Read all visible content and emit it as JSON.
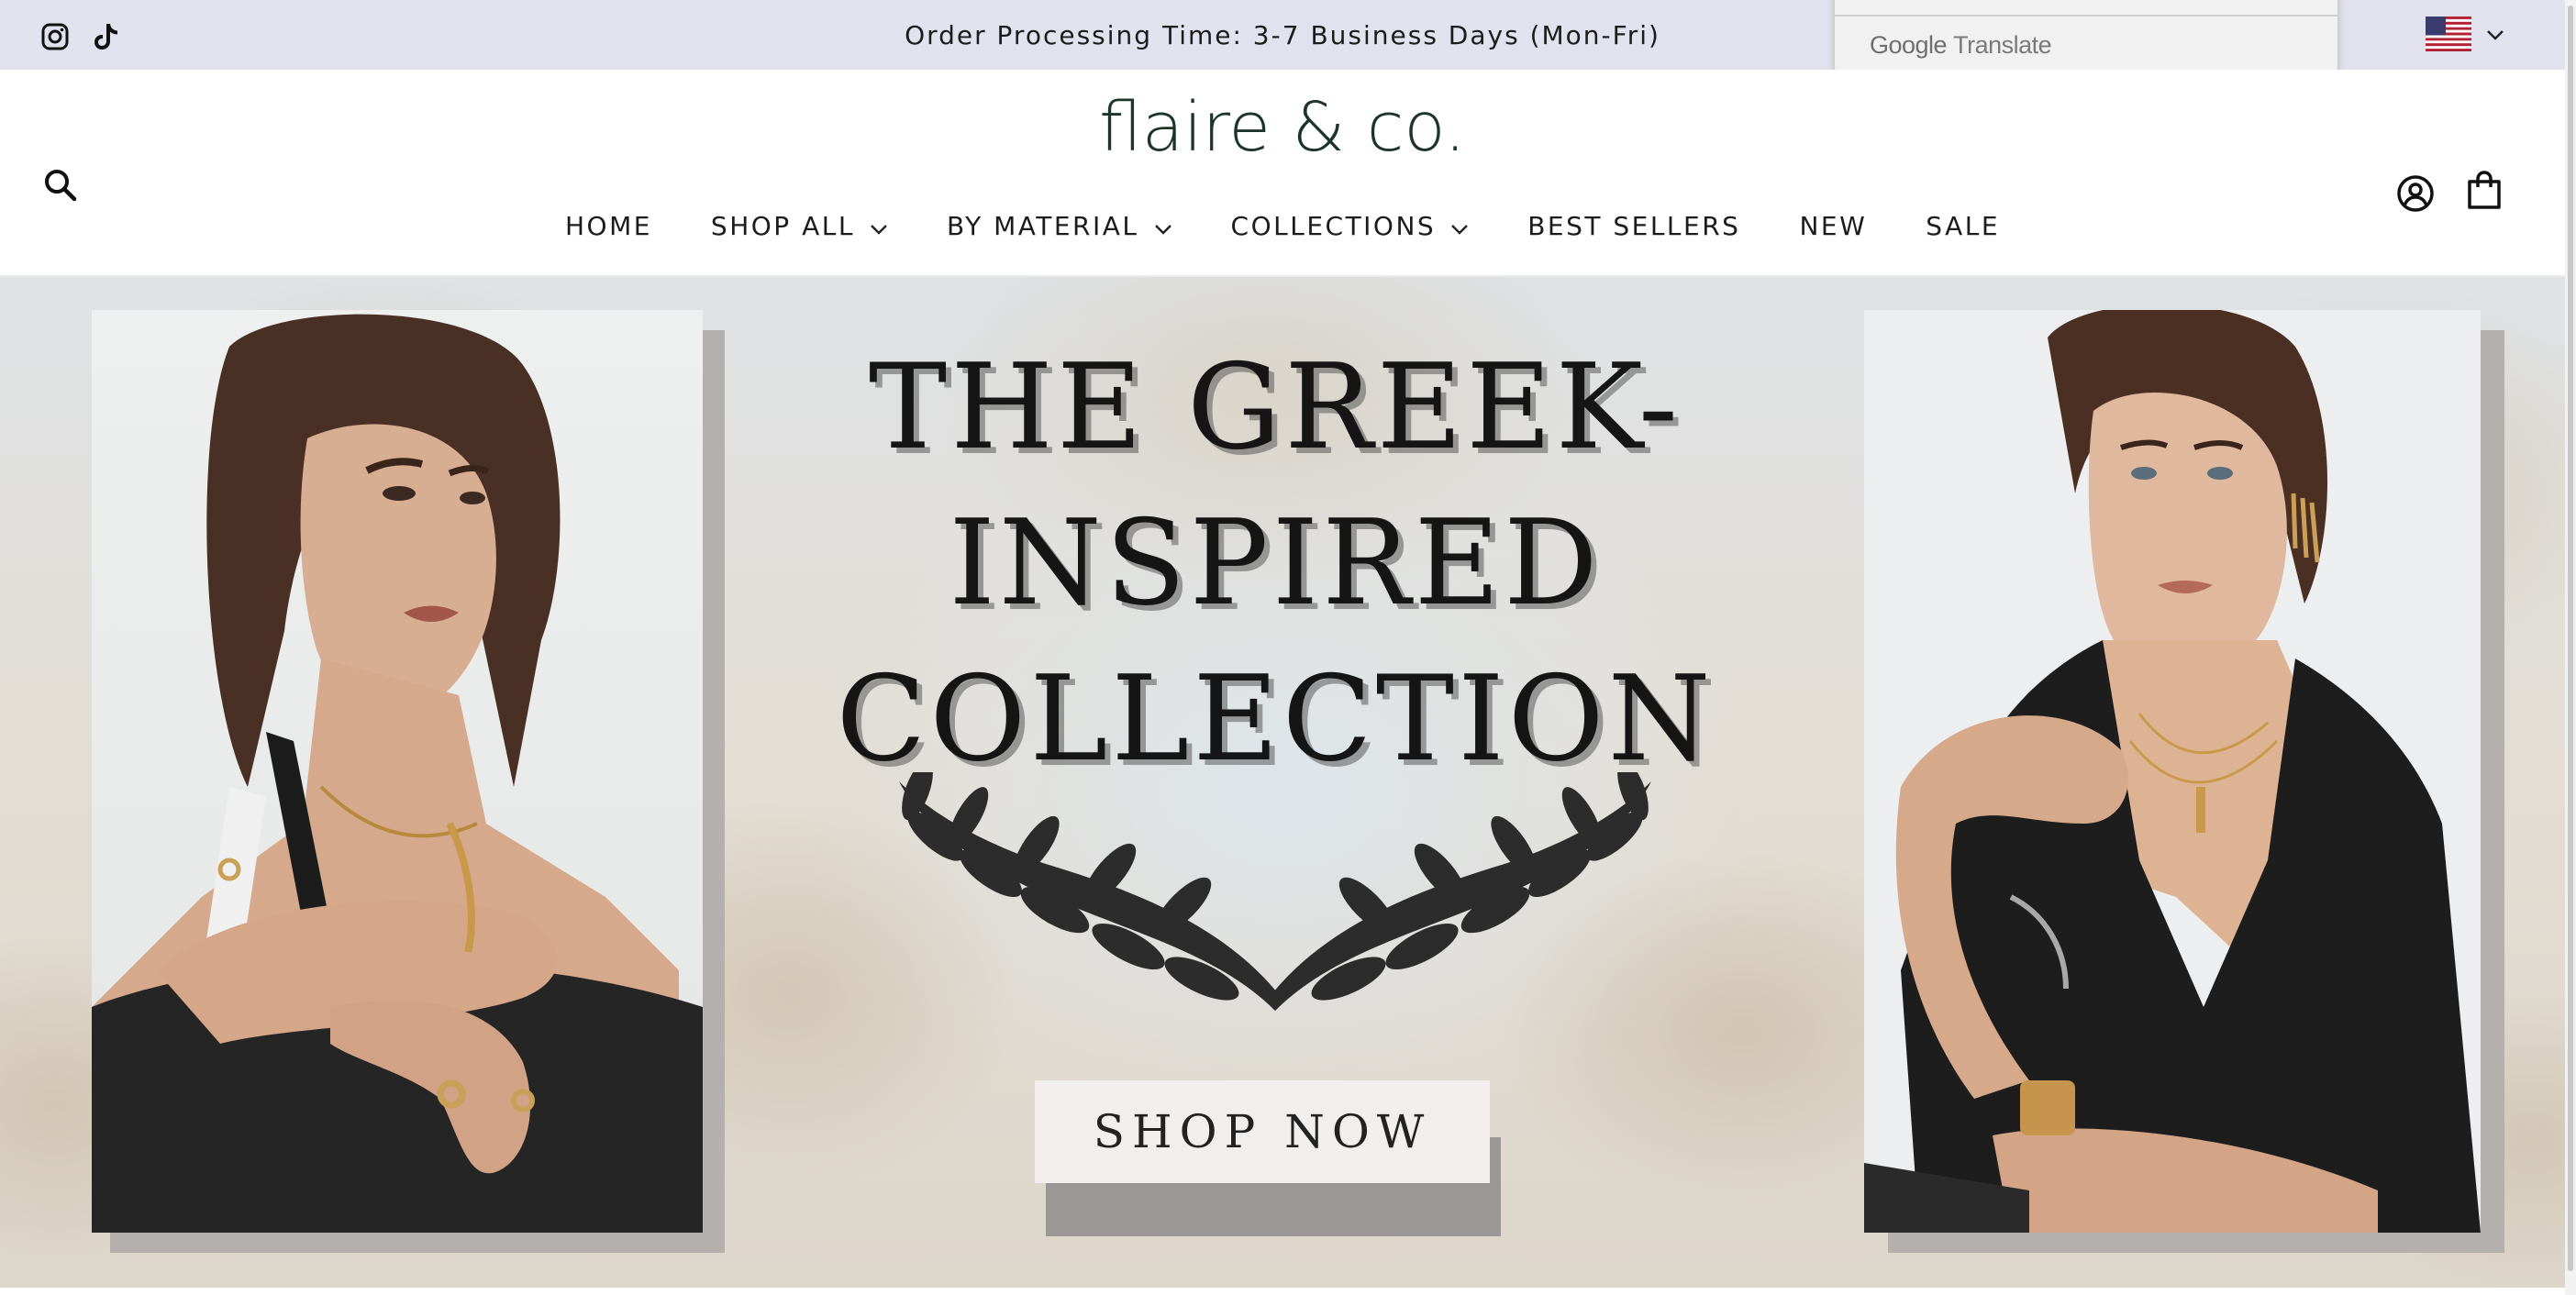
{
  "announcement": {
    "text": "Order Processing Time: 3-7 Business Days (Mon-Fri)",
    "social": [
      "instagram-icon",
      "tiktok-icon"
    ],
    "background": "#e2e1ee"
  },
  "translate": {
    "google": "Google",
    "translate": "Translate"
  },
  "header": {
    "logo": "flaire & co.",
    "logo_color": "#1d3529",
    "icons": [
      "search-icon",
      "account-icon",
      "cart-icon"
    ]
  },
  "nav": {
    "items": [
      {
        "label": "HOME",
        "dropdown": false
      },
      {
        "label": "SHOP ALL",
        "dropdown": true
      },
      {
        "label": "BY MATERIAL",
        "dropdown": true
      },
      {
        "label": "COLLECTIONS",
        "dropdown": true
      },
      {
        "label": "BEST SELLERS",
        "dropdown": false
      },
      {
        "label": "NEW",
        "dropdown": false
      },
      {
        "label": "SALE",
        "dropdown": false
      }
    ]
  },
  "hero": {
    "title_line1": "THE GREEK-",
    "title_line2": "INSPIRED",
    "title_line3": "COLLECTION",
    "cta": "SHOP NOW"
  }
}
